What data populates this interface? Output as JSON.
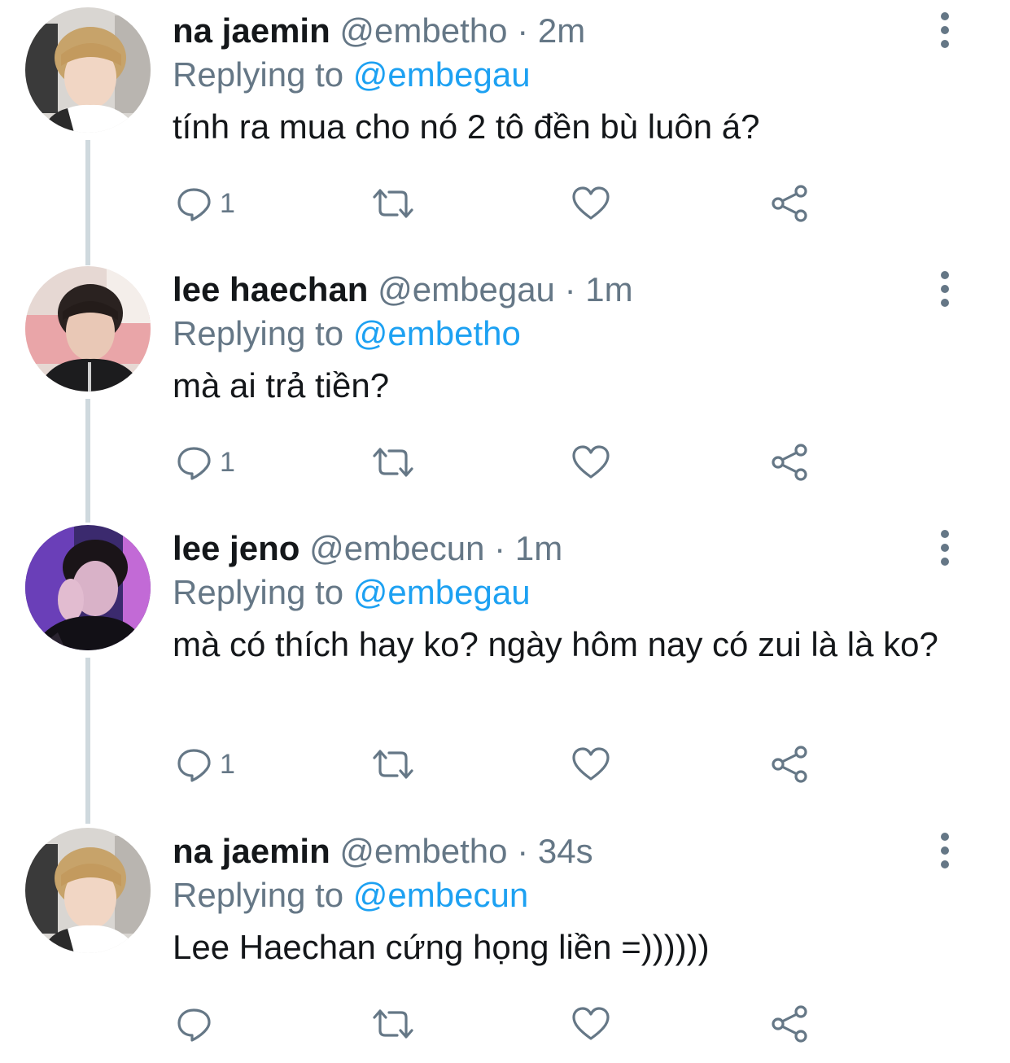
{
  "colors": {
    "name": "#14171a",
    "meta": "#657786",
    "link": "#1da1f2",
    "thread_line": "#cfd9de"
  },
  "icons": [
    "reply-icon",
    "retweet-icon",
    "like-icon",
    "share-icon",
    "more-icon"
  ],
  "tweets": [
    {
      "name": "na jaemin",
      "handle": "@embetho",
      "time": "2m",
      "replying_label": "Replying to",
      "replying_to": "@embegau",
      "text": "tính ra mua cho nó 2 tô đền bù luôn á?",
      "reply_count": "1"
    },
    {
      "name": "lee haechan",
      "handle": "@embegau",
      "time": "1m",
      "replying_label": "Replying to",
      "replying_to": "@embetho",
      "text": "mà ai trả tiền?",
      "reply_count": "1"
    },
    {
      "name": "lee jeno",
      "handle": "@embecun",
      "time": "1m",
      "replying_label": "Replying to",
      "replying_to": "@embegau",
      "text": "mà có thích hay ko? ngày hôm nay có zui là là ko?",
      "reply_count": "1"
    },
    {
      "name": "na jaemin",
      "handle": "@embetho",
      "time": "34s",
      "replying_label": "Replying to",
      "replying_to": "@embecun",
      "text": "Lee Haechan cứng họng liền =))))))",
      "reply_count": ""
    }
  ]
}
